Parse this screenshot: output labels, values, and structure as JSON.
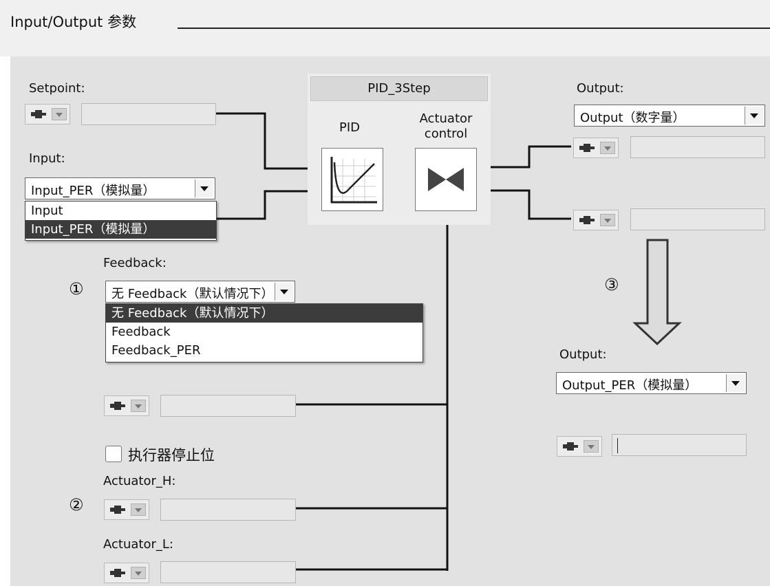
{
  "header": {
    "title": "Input/Output 参数"
  },
  "setpoint": {
    "label": "Setpoint:"
  },
  "input": {
    "label": "Input:",
    "selected": "Input_PER（模拟量）",
    "options": [
      "Input",
      "Input_PER（模拟量）"
    ]
  },
  "block": {
    "title": "PID_3Step",
    "pid_label": "PID",
    "actuator_label": "Actuator control"
  },
  "output_top": {
    "label": "Output:",
    "selected": "Output（数字量）"
  },
  "feedback": {
    "label": "Feedback:",
    "selected": "无 Feedback（默认情况下）",
    "options": [
      "无 Feedback（默认情况下）",
      "Feedback",
      "Feedback_PER"
    ]
  },
  "markers": {
    "one": "①",
    "two": "②",
    "three": "③"
  },
  "actuator_stop": {
    "label": "执行器停止位",
    "checked": false
  },
  "actuator_h": {
    "label": "Actuator_H:"
  },
  "actuator_l": {
    "label": "Actuator_L:"
  },
  "output_bottom": {
    "label": "Output:",
    "selected": "Output_PER（模拟量）"
  },
  "colors": {
    "panel": "#e2e2e2",
    "selected_option": "#3c3c3c",
    "wire": "#111111"
  },
  "icons": [
    "plug-connector-icon",
    "dropdown-arrow-icon",
    "pid-graph-icon",
    "valve-icon",
    "down-arrow-icon"
  ]
}
